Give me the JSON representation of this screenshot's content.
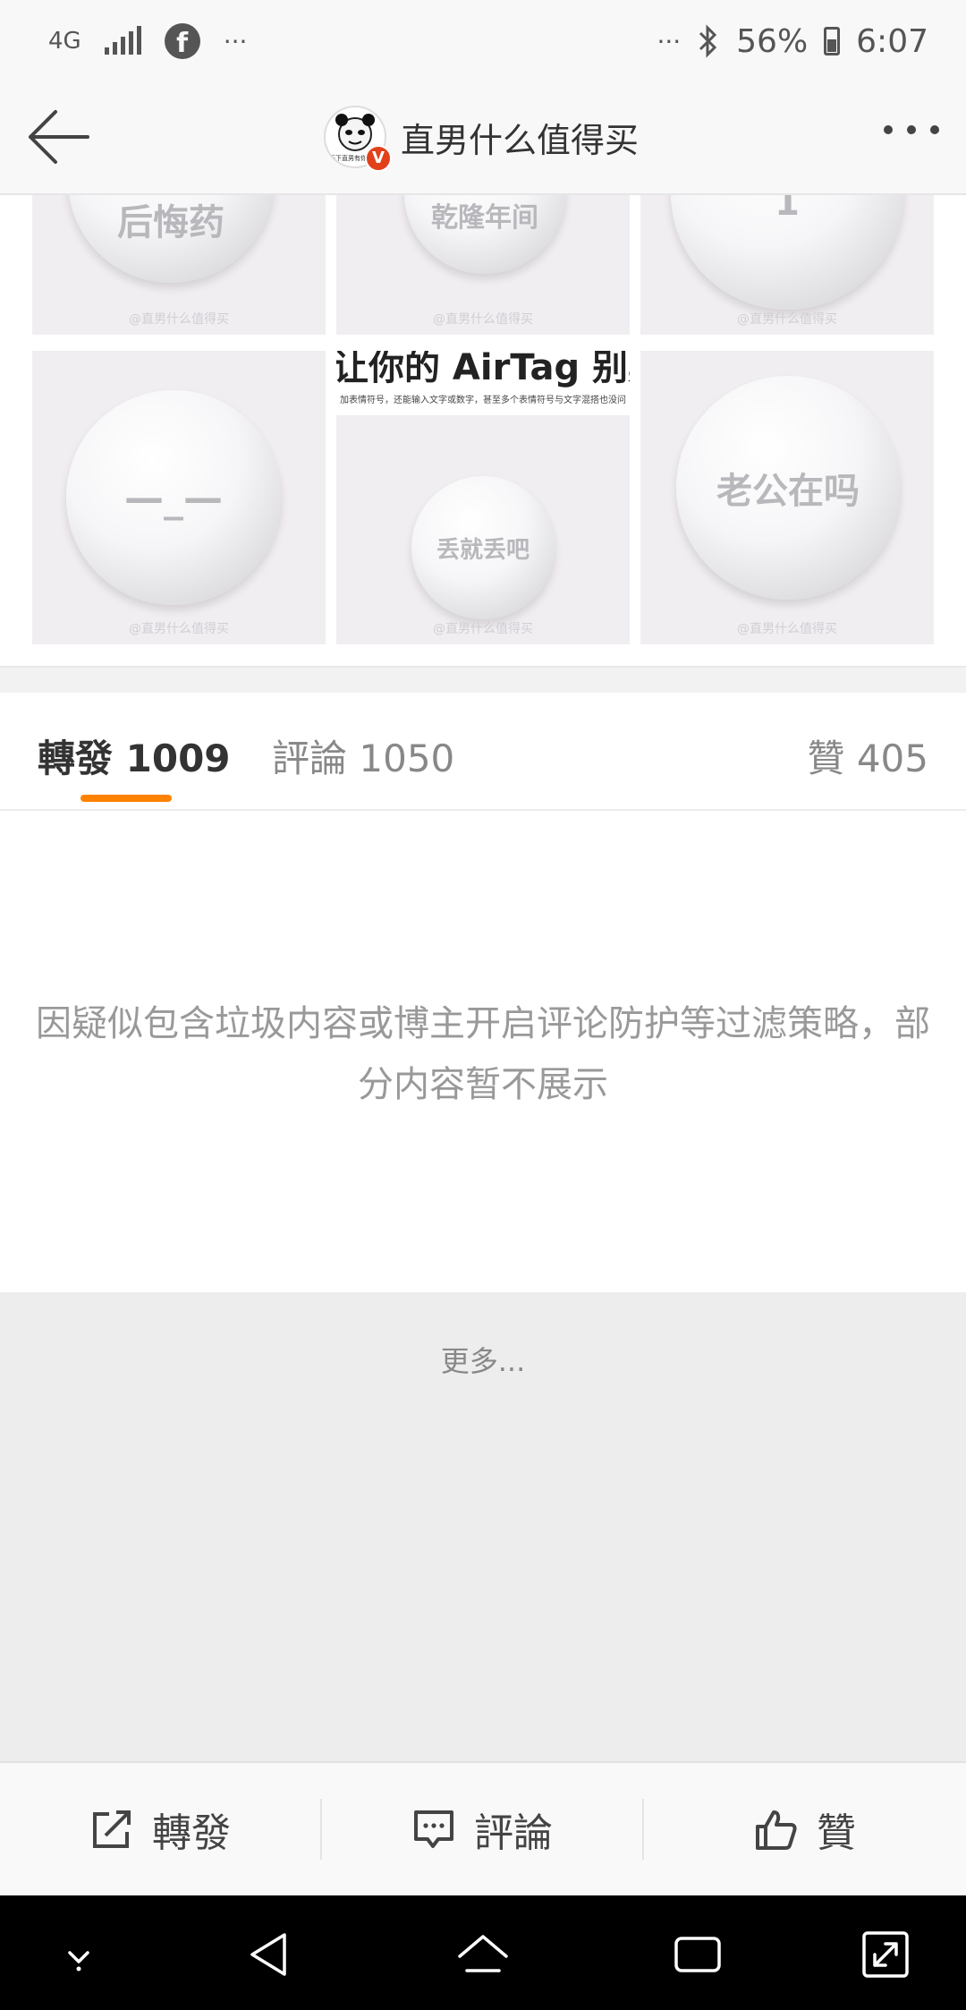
{
  "status_bar": {
    "network": "4G",
    "more_left": "···",
    "more_right": "···",
    "battery": "56%",
    "time": "6:07",
    "icons": [
      "signal-icon",
      "facebook-icon",
      "bluetooth-icon",
      "battery-icon"
    ]
  },
  "nav": {
    "title": "直男什么值得买",
    "avatar_caption": "天下直男有你",
    "verified_badge": "V",
    "icons": [
      "back-arrow-icon",
      "more-dots-icon"
    ]
  },
  "images": {
    "row1": [
      "后悔药",
      "乾隆年间",
      "1"
    ],
    "row2": {
      "left": "—_—",
      "middle_header": "让你的 AirTag 别具个性。",
      "middle_subheader": "加表情符号，还能输入文字或数字，甚至多个表情符号与文字混搭也没问",
      "middle_ball": "丢就丢吧",
      "right": "老公在吗"
    },
    "watermark": "@直男什么值得买"
  },
  "tabs": [
    {
      "label": "轉發",
      "count": "1009",
      "active": true
    },
    {
      "label": "評論",
      "count": "1050",
      "active": false
    },
    {
      "label": "贊",
      "count": "405",
      "active": false
    }
  ],
  "notice": {
    "line1": "因疑似包含垃圾内容或博主开启评论防护等过滤策略，部",
    "line2": "分内容暂不展示"
  },
  "more_link": "更多...",
  "toolbar": {
    "repost": "轉發",
    "comment": "評論",
    "like": "贊"
  },
  "colors": {
    "accent": "#ff8200",
    "verified": "#e2401b",
    "notice_text": "#999999"
  }
}
